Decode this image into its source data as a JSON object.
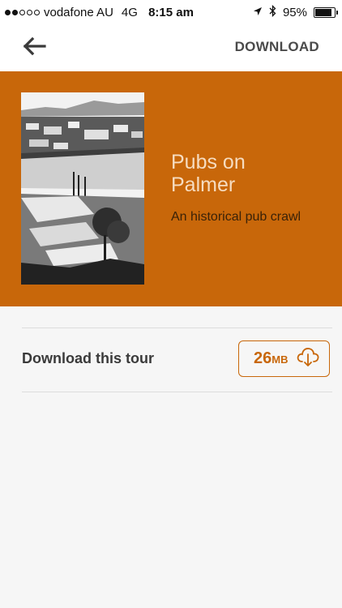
{
  "status_bar": {
    "carrier": "vodafone AU",
    "network": "4G",
    "time": "8:15 am",
    "battery_percent": "95%",
    "battery_level": 0.95,
    "signal_bars_filled": 2,
    "signal_bars_total": 5,
    "icons": [
      "location-arrow-icon",
      "bluetooth-icon",
      "battery-icon"
    ]
  },
  "nav": {
    "back_icon": "arrow-left-icon",
    "action_label": "DOWNLOAD"
  },
  "tour": {
    "title_line1": "Pubs on",
    "title_line2": "Palmer",
    "subtitle": "An historical pub crawl",
    "cover_image": "historical-town-photo"
  },
  "download_row": {
    "label": "Download this tour",
    "size_value": "26",
    "size_unit": "MB",
    "icon": "cloud-download-icon"
  },
  "colors": {
    "accent": "#c8670a",
    "hero_title": "#f6dcc0",
    "hero_subtitle": "#3a2208",
    "background": "#f6f6f6"
  }
}
